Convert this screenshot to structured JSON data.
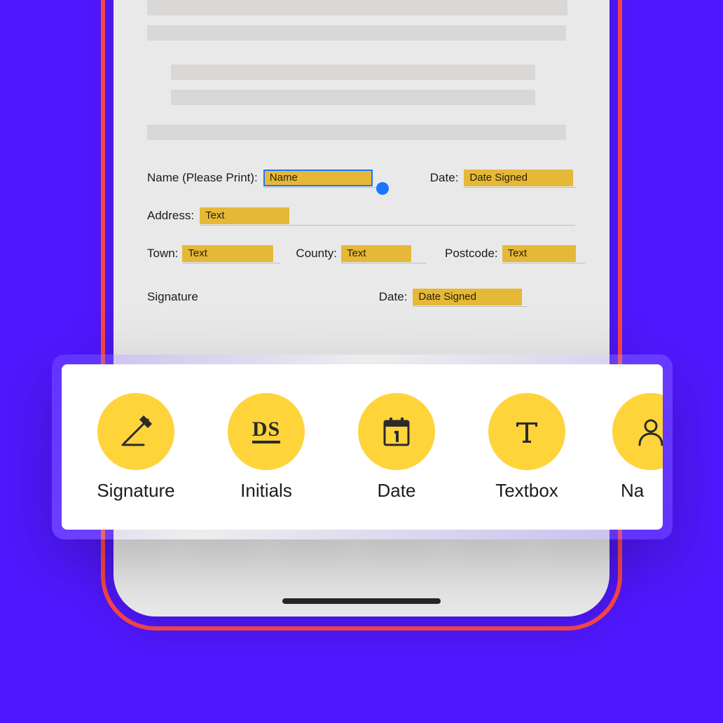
{
  "form": {
    "name_label": "Name (Please Print):",
    "date_label": "Date:",
    "address_label": "Address:",
    "town_label": "Town:",
    "county_label": "County:",
    "postcode_label": "Postcode:",
    "signature_label": "Signature",
    "date2_label": "Date:",
    "fields": {
      "name": {
        "placeholder": "Name",
        "selected": true
      },
      "date": {
        "placeholder": "Date Signed"
      },
      "address": {
        "placeholder": "Text"
      },
      "town": {
        "placeholder": "Text"
      },
      "county": {
        "placeholder": "Text"
      },
      "postcode": {
        "placeholder": "Text"
      },
      "date2": {
        "placeholder": "Date Signed"
      }
    }
  },
  "toolbar": {
    "initials_glyph": "DS",
    "items": [
      {
        "id": "signature",
        "label": "Signature",
        "icon": "pen-icon"
      },
      {
        "id": "initials",
        "label": "Initials",
        "icon": "initials-icon"
      },
      {
        "id": "date",
        "label": "Date",
        "icon": "calendar-icon"
      },
      {
        "id": "textbox",
        "label": "Textbox",
        "icon": "text-icon"
      },
      {
        "id": "name",
        "label": "Na",
        "icon": "person-icon"
      }
    ]
  },
  "colors": {
    "background": "#5018FF",
    "accent_outline": "#FF4A4A",
    "field_tag": "#E6B838",
    "selection": "#1976ff",
    "tool_circle": "#FFD43B"
  }
}
